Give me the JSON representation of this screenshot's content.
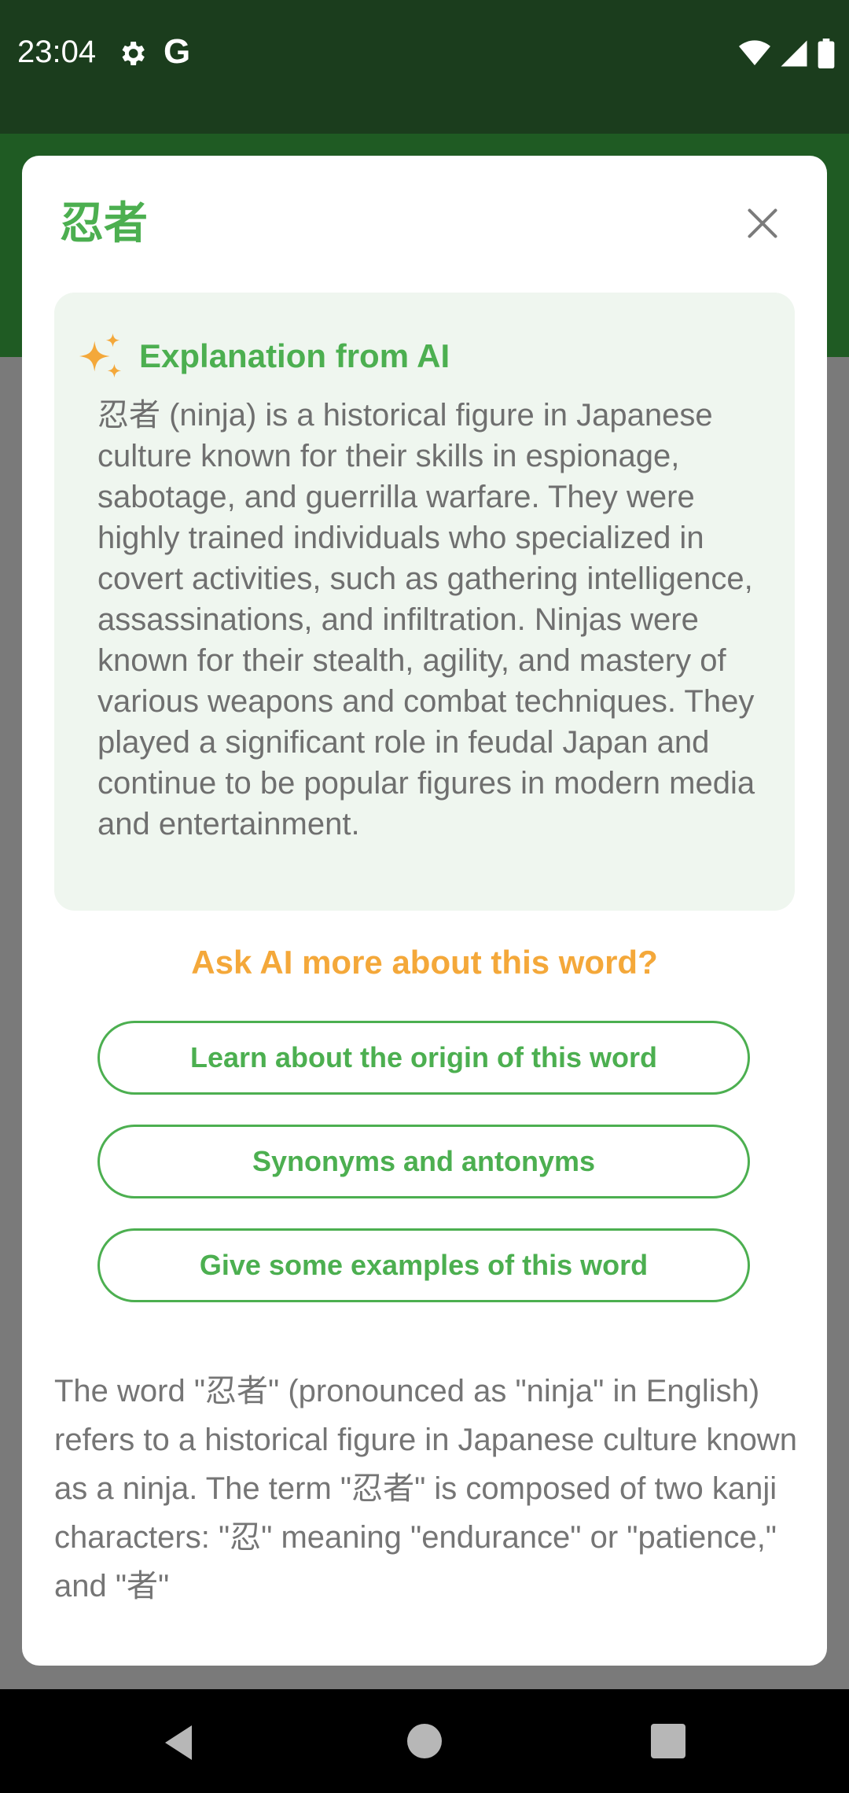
{
  "status_bar": {
    "time": "23:04",
    "google_letter": "G",
    "icons": [
      "gear-icon",
      "wifi-icon",
      "signal-icon",
      "battery-icon"
    ]
  },
  "dialog": {
    "title": "忍者",
    "close_icon": "close-icon",
    "ai_card": {
      "icon": "sparkle-icon",
      "title": "Explanation from AI",
      "body": "忍者 (ninja) is a historical figure in Japanese culture known for their skills in espionage, sabotage, and guerrilla warfare. They were highly trained individuals who specialized in covert activities, such as gathering intelligence, assassinations, and infiltration. Ninjas were known for their stealth, agility, and mastery of various weapons and combat techniques. They played a significant role in feudal Japan and continue to be popular figures in modern media and entertainment."
    },
    "ask_label": "Ask AI more about this word?",
    "options": [
      {
        "label": "Learn about the origin of this word"
      },
      {
        "label": "Synonyms and antonyms"
      },
      {
        "label": "Give some examples of this word"
      }
    ],
    "answer_text": "The word \"忍者\" (pronounced as \"ninja\" in English) refers to a historical figure in Japanese culture known as a ninja. The term \"忍者\" is composed of two kanji characters: \"忍\" meaning \"endurance\" or \"patience,\" and \"者\""
  },
  "nav_bar": {
    "icons": [
      "back-icon",
      "home-icon",
      "recents-icon"
    ]
  },
  "colors": {
    "status_bar_bg": "#1b3d1d",
    "accent_green": "#4caf50",
    "accent_orange": "#f4a83a",
    "card_bg": "#eff6ef",
    "scrim": "#7a7a7a"
  }
}
